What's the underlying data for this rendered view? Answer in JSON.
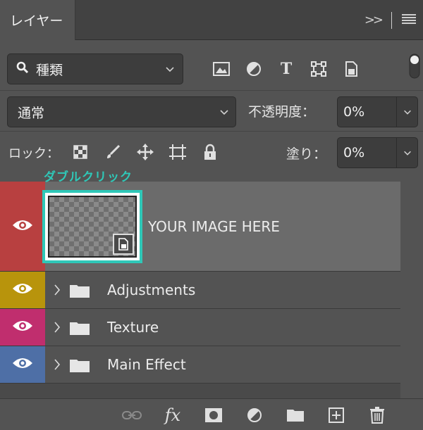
{
  "panel": {
    "tab_title": "レイヤー",
    "overflow_chevron": ">>"
  },
  "filter": {
    "kind_label": "種類"
  },
  "blend": {
    "mode": "通常",
    "opacity_label": "不透明度：",
    "opacity_value": "0%"
  },
  "lock": {
    "label": "ロック：",
    "fill_label": "塗り：",
    "fill_value": "0%"
  },
  "annotation": "ダブルクリック",
  "layers": [
    {
      "name": "YOUR IMAGE HERE",
      "color": "#b84040",
      "type": "smart-object"
    },
    {
      "name": "Adjustments",
      "color": "#b8940c",
      "type": "group"
    },
    {
      "name": "Texture",
      "color": "#c02e6e",
      "type": "group"
    },
    {
      "name": "Main Effect",
      "color": "#4e6fa6",
      "type": "group"
    }
  ],
  "colors": {
    "highlight": "#2fc8b8"
  }
}
